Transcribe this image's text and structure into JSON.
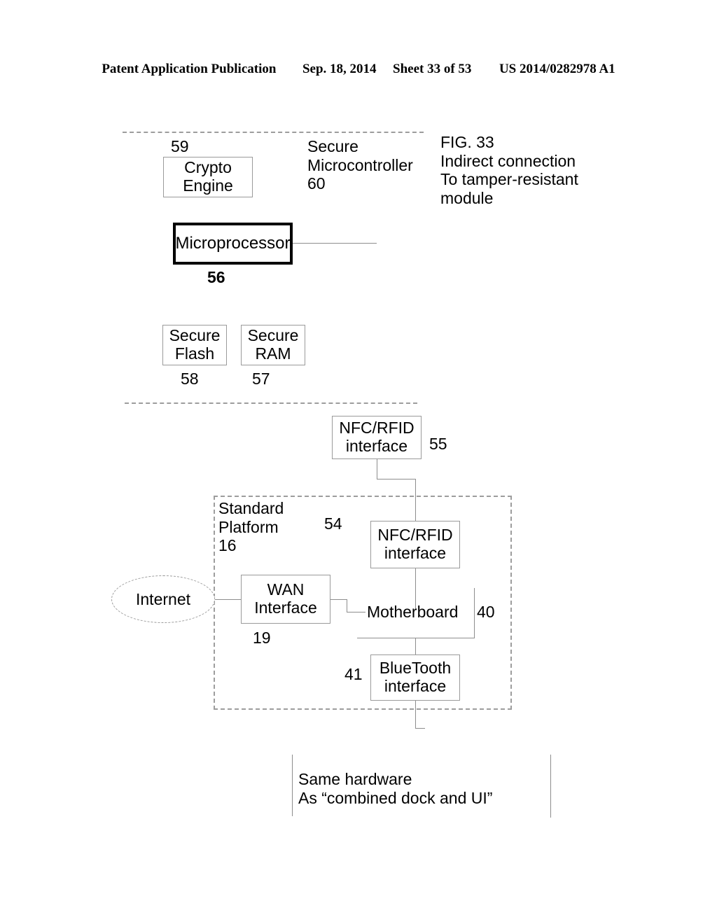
{
  "header": {
    "publication": "Patent Application Publication",
    "date": "Sep. 18, 2014",
    "sheet": "Sheet 33 of 53",
    "number": "US 2014/0282978 A1"
  },
  "figure": {
    "caption": "FIG. 33\nIndirect connection\nTo tamper-resistant\nmodule"
  },
  "secure_module": {
    "title": "Secure\nMicrocontroller",
    "title_ref": "60",
    "crypto_engine": {
      "label": "Crypto\nEngine",
      "ref": "59"
    },
    "microprocessor": {
      "label": "Microprocessor",
      "ref": "56"
    },
    "secure_flash": {
      "label": "Secure\nFlash",
      "ref": "58"
    },
    "secure_ram": {
      "label": "Secure\nRAM",
      "ref": "57"
    }
  },
  "nfc_outer": {
    "label": "NFC/RFID\ninterface",
    "ref": "55"
  },
  "standard_platform": {
    "title": "Standard\nPlatform",
    "ref": "16",
    "nfc_interface": {
      "label": "NFC/RFID\ninterface",
      "ref": "54"
    },
    "wan_interface": {
      "label": "WAN\nInterface",
      "ref": "19"
    },
    "motherboard": {
      "label": "Motherboard",
      "ref": "40"
    },
    "bluetooth_interface": {
      "label": "BlueTooth\ninterface",
      "ref": "41"
    }
  },
  "internet": {
    "label": "Internet"
  },
  "footer_note": {
    "text": "Same hardware\nAs “combined dock and UI”"
  }
}
